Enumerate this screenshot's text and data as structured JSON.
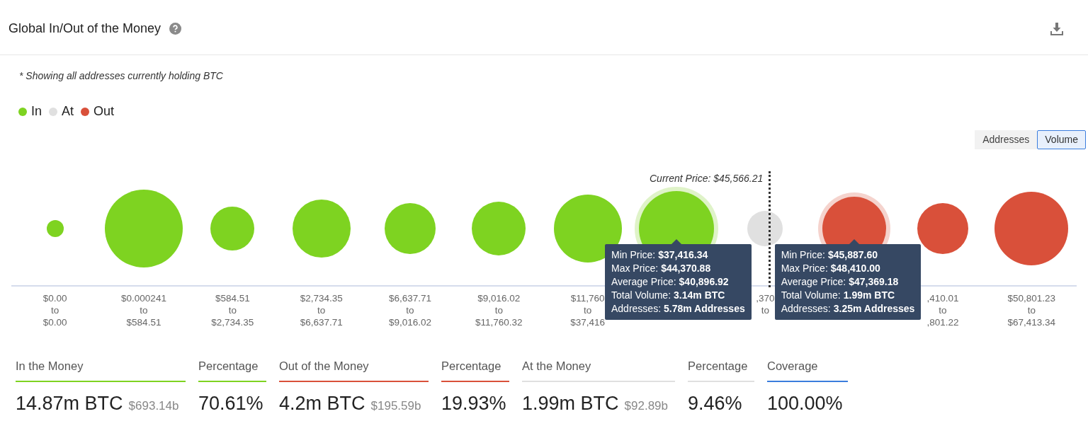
{
  "header": {
    "title": "Global In/Out of the Money"
  },
  "note": "* Showing all addresses currently holding BTC",
  "legend": [
    {
      "label": "In",
      "color": "#7ed321"
    },
    {
      "label": "At",
      "color": "#e0e0e0"
    },
    {
      "label": "Out",
      "color": "#d9503a"
    }
  ],
  "toggle": [
    {
      "label": "Addresses",
      "selected": false
    },
    {
      "label": "Volume",
      "selected": true
    }
  ],
  "current_price": "Current Price: $45,566.21",
  "buckets": [
    {
      "kind": "in",
      "hovered": false,
      "from": "$0.00",
      "to": "to",
      "upto": "$0.00"
    },
    {
      "kind": "in",
      "hovered": false,
      "from": "$0.000241",
      "to": "to",
      "upto": "$584.51"
    },
    {
      "kind": "in",
      "hovered": false,
      "from": "$584.51",
      "to": "to",
      "upto": "$2,734.35"
    },
    {
      "kind": "in",
      "hovered": false,
      "from": "$2,734.35",
      "to": "to",
      "upto": "$6,637.71"
    },
    {
      "kind": "in",
      "hovered": false,
      "from": "$6,637.71",
      "to": "to",
      "upto": "$9,016.02"
    },
    {
      "kind": "in",
      "hovered": false,
      "from": "$9,016.02",
      "to": "to",
      "upto": "$11,760.32"
    },
    {
      "kind": "in",
      "hovered": false,
      "from": "$11,760",
      "to": "to",
      "upto": "$37,416"
    },
    {
      "kind": "in",
      "hovered": true,
      "tooltip": [
        {
          "label": "Min Price:",
          "value": "$37,416.34"
        },
        {
          "label": "Max Price:",
          "value": "$44,370.88"
        },
        {
          "label": "Average Price:",
          "value": "$40,896.92"
        },
        {
          "label": "Total Volume:",
          "value": "3.14m BTC"
        },
        {
          "label": "Addresses:",
          "value": "5.78m Addresses"
        }
      ]
    },
    {
      "kind": "at",
      "hovered": false,
      "from": ",370",
      "to": "to"
    },
    {
      "kind": "out",
      "hovered": true,
      "tooltip": [
        {
          "label": "Min Price:",
          "value": "$45,887.60"
        },
        {
          "label": "Max Price:",
          "value": "$48,410.00"
        },
        {
          "label": "Average Price:",
          "value": "$47,369.18"
        },
        {
          "label": "Total Volume:",
          "value": "1.99m BTC"
        },
        {
          "label": "Addresses:",
          "value": "3.25m Addresses"
        }
      ]
    },
    {
      "kind": "out",
      "hovered": false,
      "from": ",410.01",
      "to": "to",
      "upto": ",801.22"
    },
    {
      "kind": "out",
      "hovered": false,
      "from": "$50,801.23",
      "to": "to",
      "upto": "$67,413.34"
    }
  ],
  "stats": [
    {
      "label": "In the Money",
      "value": "14.87m BTC",
      "sub": "$693.14b",
      "color": "#7ed321"
    },
    {
      "label": "Percentage",
      "value": "70.61%",
      "color": "#7ed321"
    },
    {
      "label": "Out of the Money",
      "value": "4.2m BTC",
      "sub": "$195.59b",
      "color": "#d9503a"
    },
    {
      "label": "Percentage",
      "value": "19.93%",
      "color": "#d9503a"
    },
    {
      "label": "At the Money",
      "value": "1.99m BTC",
      "sub": "$92.89b",
      "color": "#e0e0e0"
    },
    {
      "label": "Percentage",
      "value": "9.46%",
      "color": "#e0e0e0"
    },
    {
      "label": "Coverage",
      "value": "100.00%",
      "color": "#3b7ddd"
    }
  ]
}
